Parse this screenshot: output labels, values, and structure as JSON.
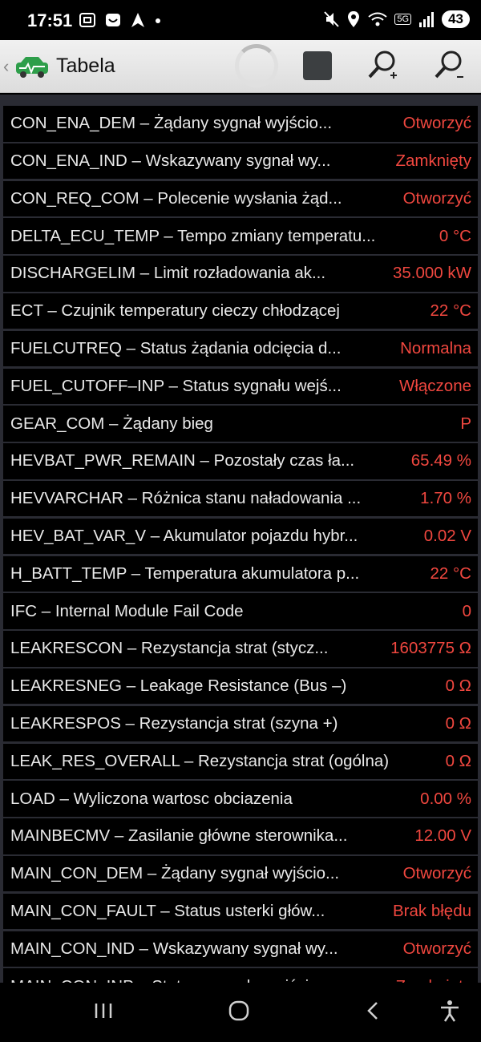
{
  "status_bar": {
    "time": "17:51",
    "battery": "43",
    "network_label": "5G",
    "icons_left": [
      "screenshot-icon",
      "app-icon",
      "navigation-icon",
      "dot-icon"
    ],
    "icons_right": [
      "mute-icon",
      "location-icon",
      "wifi-icon",
      "signal-icon",
      "battery-icon"
    ]
  },
  "toolbar": {
    "title": "Tabela",
    "buttons": [
      "spinner",
      "stop",
      "zoom-in",
      "zoom-out"
    ]
  },
  "rows": [
    {
      "label": "CON_ENA_DEM – Żądany sygnał wyjścio...",
      "value": "Otworzyć"
    },
    {
      "label": "CON_ENA_IND – Wskazywany sygnał wy...",
      "value": "Zamknięty"
    },
    {
      "label": "CON_REQ_COM – Polecenie wysłania żąd...",
      "value": "Otworzyć"
    },
    {
      "label": "DELTA_ECU_TEMP – Tempo zmiany temperatu...",
      "value": "0 °C"
    },
    {
      "label": "DISCHARGELIM – Limit rozładowania ak...",
      "value": "35.000 kW"
    },
    {
      "label": "ECT – Czujnik temperatury cieczy chłodzącej",
      "value": "22 °C"
    },
    {
      "label": "FUELCUTREQ – Status żądania odcięcia d...",
      "value": "Normalna"
    },
    {
      "label": "FUEL_CUTOFF–INP – Status sygnału wejś...",
      "value": "Włączone"
    },
    {
      "label": "GEAR_COM – Żądany bieg",
      "value": "P"
    },
    {
      "label": "HEVBAT_PWR_REMAIN – Pozostały czas ła...",
      "value": "65.49 %"
    },
    {
      "label": "HEVVARCHAR – Różnica stanu naładowania ...",
      "value": "1.70 %"
    },
    {
      "label": "HEV_BAT_VAR_V – Akumulator pojazdu hybr...",
      "value": "0.02 V"
    },
    {
      "label": "H_BATT_TEMP – Temperatura akumulatora p...",
      "value": "22 °C"
    },
    {
      "label": "IFC – Internal Module Fail Code",
      "value": "0"
    },
    {
      "label": "LEAKRESCON – Rezystancja strat (stycz...",
      "value": "1603775 Ω"
    },
    {
      "label": "LEAKRESNEG – Leakage Resistance (Bus –)",
      "value": "0 Ω"
    },
    {
      "label": "LEAKRESPOS – Rezystancja strat (szyna +)",
      "value": "0 Ω"
    },
    {
      "label": "LEAK_RES_OVERALL – Rezystancja strat (ogólna)",
      "value": "0 Ω"
    },
    {
      "label": "LOAD – Wyliczona wartosc obciazenia",
      "value": "0.00 %"
    },
    {
      "label": "MAINBECMV – Zasilanie główne sterownika...",
      "value": "12.00 V"
    },
    {
      "label": "MAIN_CON_DEM – Żądany sygnał wyjścio...",
      "value": "Otworzyć"
    },
    {
      "label": "MAIN_CON_FAULT – Status usterki głów...",
      "value": "Brak błędu"
    },
    {
      "label": "MAIN_CON_IND – Wskazywany sygnał wy...",
      "value": "Otworzyć"
    },
    {
      "label": "MAIN_CON_INP – Status sygnału wejści...",
      "value": "Zamknięty"
    }
  ],
  "colors": {
    "value_red": "#f0473f",
    "label_white": "#e9e9e9",
    "row_bg": "#000000",
    "separator": "#2a2b33",
    "toolbar_bg": "#e6e6e6"
  },
  "nav": {
    "buttons": [
      "recents-icon",
      "home-icon",
      "back-icon",
      "accessibility-icon"
    ]
  }
}
